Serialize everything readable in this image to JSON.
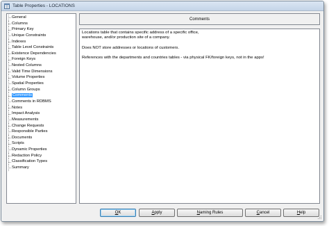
{
  "window": {
    "title": "Table Properties - LOCATIONS"
  },
  "nav": {
    "items": [
      "General",
      "Columns",
      "Primary Key",
      "Unique Constraints",
      "Indexes",
      "Table Level Constraints",
      "Existence Dependencies",
      "Foreign Keys",
      "Nested Columns",
      "Valid Time Dimensions",
      "Volume Properties",
      "Spatial Properties",
      "Column Groups",
      "Comments",
      "Comments in RDBMS",
      "Notes",
      "Impact Analysis",
      "Measurements",
      "Change Requests",
      "Responsible Parties",
      "Documents",
      "Scripts",
      "Dynamic Properties",
      "Redaction Policy",
      "Classification Types",
      "Summary"
    ],
    "selected": "Comments"
  },
  "section": {
    "title": "Comments"
  },
  "comments": {
    "paragraphs": [
      "Locations table that contains specific address of a specific office,\nwarehouse, and/or production site of a company.",
      "Does NOT store addresses or locations of customers.",
      "References with the departments and countries tables - via physical FK/foreign keys, not in the apps!"
    ]
  },
  "buttons": {
    "ok": {
      "first": "O",
      "rest": "K"
    },
    "apply": {
      "first": "A",
      "rest": "pply"
    },
    "naming": {
      "first": "N",
      "rest": "aming Rules"
    },
    "cancel": {
      "first": "C",
      "rest": "ancel"
    },
    "help": {
      "first": "H",
      "rest": "elp"
    }
  },
  "colors": {
    "selection": "#3399ff",
    "titlebar": "#c4d4e8"
  },
  "icons": {
    "app": "table-properties-icon",
    "grip": "resize-grip-icon"
  }
}
